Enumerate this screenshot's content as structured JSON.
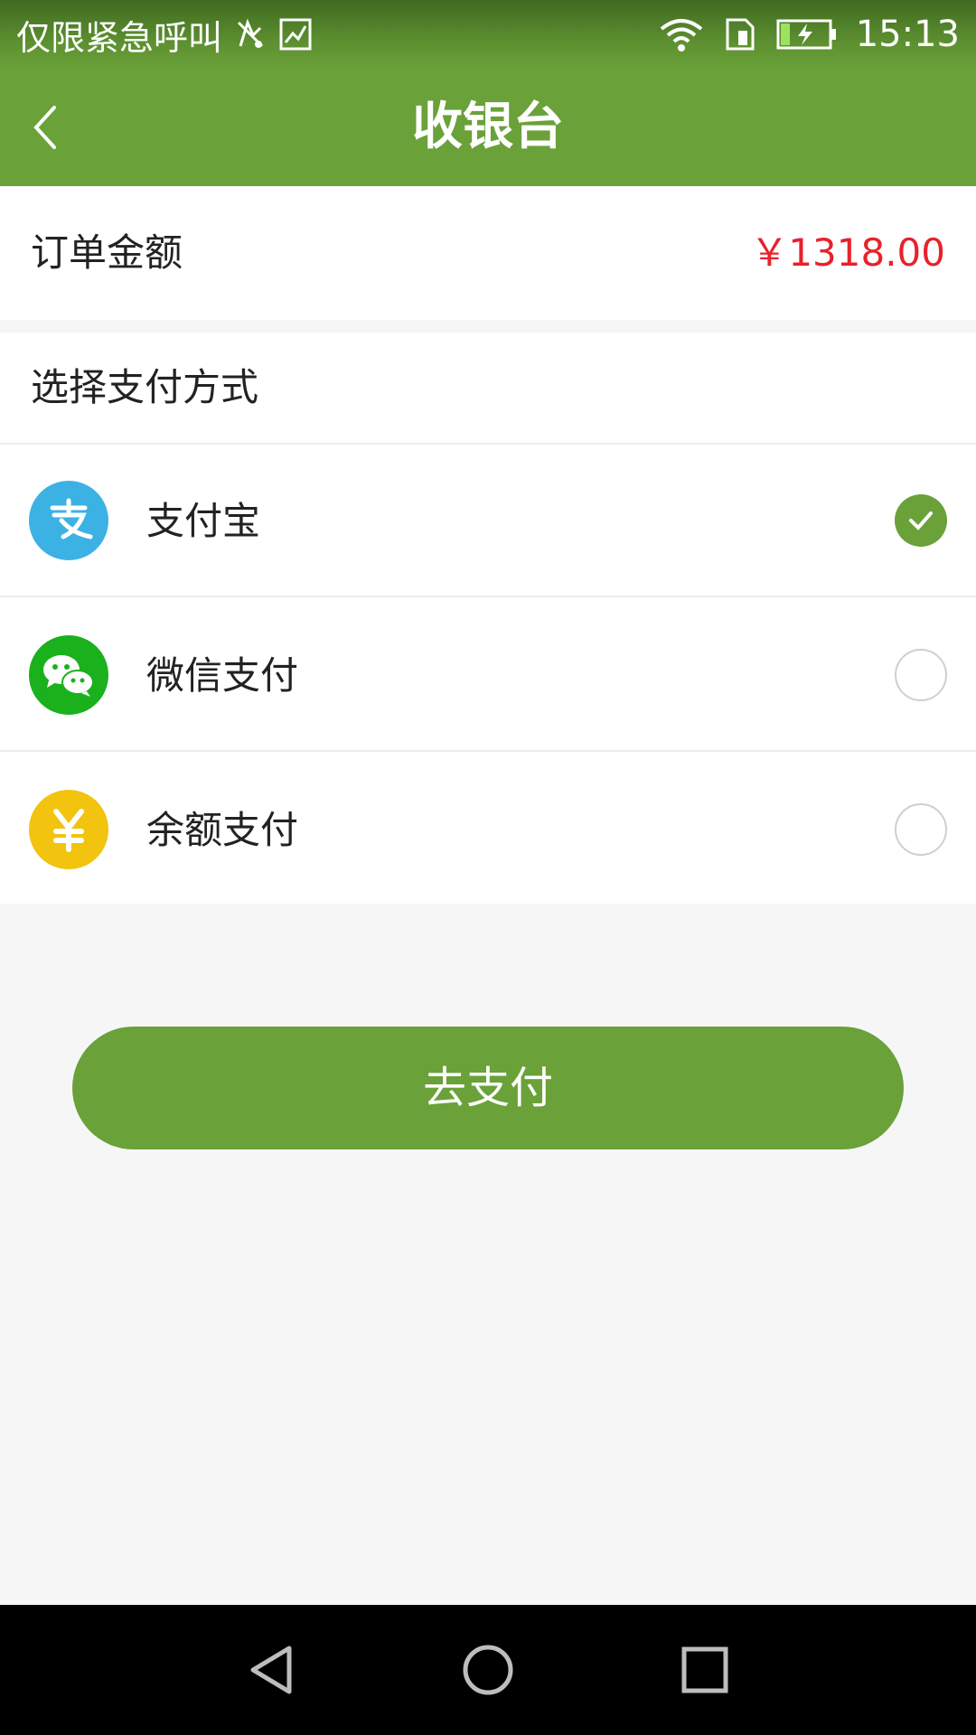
{
  "status_bar": {
    "carrier_text": "仅限紧急呼叫",
    "time": "15:13",
    "icons": [
      "no-sim-icon",
      "image-icon",
      "wifi-icon",
      "sim-card-icon",
      "battery-charging-icon"
    ]
  },
  "app_bar": {
    "title": "收银台",
    "back_icon": "chevron-left-icon"
  },
  "order": {
    "label": "订单金额",
    "amount": "￥1318.00"
  },
  "payment": {
    "section_label": "选择支付方式",
    "options": [
      {
        "label": "支付宝",
        "icon": "alipay-icon",
        "icon_color": "#3cb2e4",
        "selected": true
      },
      {
        "label": "微信支付",
        "icon": "wechat-icon",
        "icon_color": "#1ab11c",
        "selected": false
      },
      {
        "label": "余额支付",
        "icon": "balance-yen-icon",
        "icon_color": "#f2c30f",
        "selected": false
      }
    ]
  },
  "pay_button": {
    "label": "去支付"
  },
  "nav_bar": {
    "icons": [
      "back-triangle-icon",
      "home-circle-icon",
      "recents-square-icon"
    ]
  },
  "colors": {
    "primary": "#6aa139",
    "price": "#e8212b",
    "background": "#f6f6f6"
  }
}
